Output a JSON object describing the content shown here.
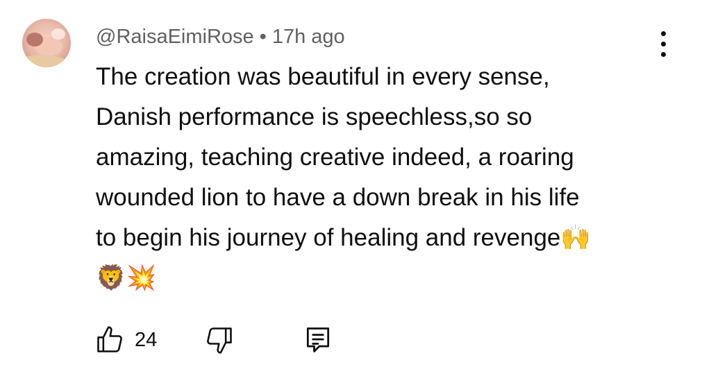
{
  "comment": {
    "author": "@RaisaEimiRose",
    "separator": "•",
    "time": "17h ago",
    "text_lines": [
      "The creation was beautiful in every sense,",
      "Danish performance is speechless,so so",
      "amazing, teaching creative indeed, a roaring",
      "wounded lion to have a down break in his life",
      "to begin his journey of healing and revenge🙌",
      "🦁💥"
    ],
    "like_count": "24"
  },
  "icons": {
    "menu": "more-vertical-icon",
    "like": "thumbs-up-icon",
    "dislike": "thumbs-down-icon",
    "reply": "reply-comment-icon"
  },
  "colors": {
    "text": "#0f0f0f",
    "secondary": "#606060",
    "background": "#ffffff"
  }
}
